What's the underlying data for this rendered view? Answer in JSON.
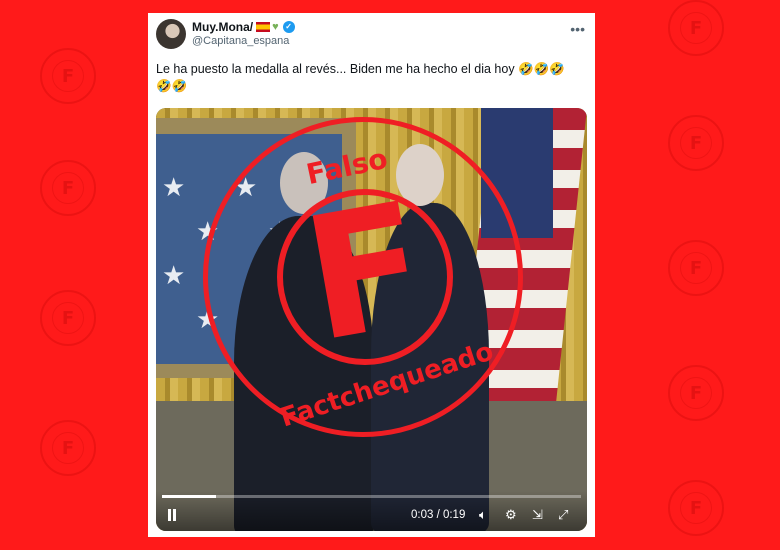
{
  "tweet": {
    "display_name": "Muy.Mona/",
    "handle": "@Capitana_espana",
    "text_line1": "Le ha puesto la medalla al revés... Biden me ha hecho el dia hoy 🤣🤣🤣",
    "text_line2": "🤣🤣",
    "more_icon": "more-icon",
    "verified_icon": "verified-badge-icon"
  },
  "stamp": {
    "top_text": "Falso",
    "center_text": "F",
    "bottom_text": "Factchequeado",
    "color": "#ef1e24"
  },
  "background_seal": {
    "letter": "F",
    "color": "#ff1a1a"
  },
  "video": {
    "time_display": "0:03 / 0:19",
    "progress_fraction": 0.13,
    "play_state_icon": "pause-icon",
    "volume_icon": "volume-icon",
    "settings_icon": "gear-icon",
    "captions_icon": "caption-icon",
    "fullscreen_icon": "fullscreen-icon"
  }
}
